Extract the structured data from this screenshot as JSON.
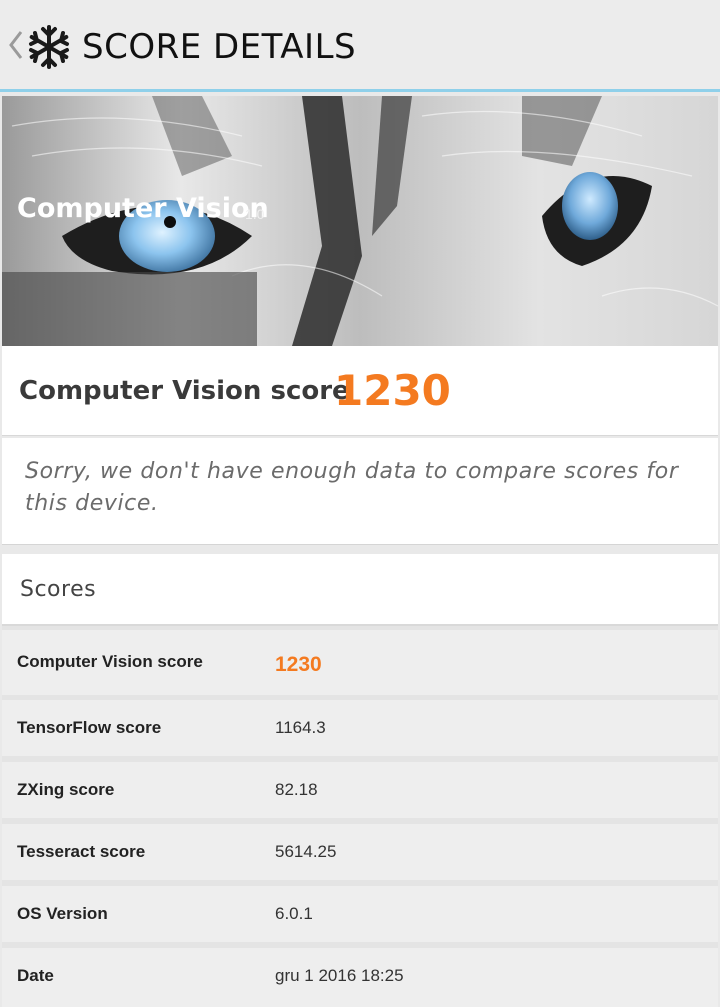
{
  "header": {
    "title": "SCORE DETAILS"
  },
  "hero": {
    "title": "Computer Vision",
    "version": "1.0"
  },
  "score_card": {
    "label": "Computer Vision score",
    "value": "1230"
  },
  "notice": {
    "text": "Sorry, we don't have enough data to compare scores for this device."
  },
  "scores": {
    "title": "Scores",
    "rows": [
      {
        "label": "Computer Vision score",
        "value": "1230"
      },
      {
        "label": "TensorFlow score",
        "value": "1164.3"
      },
      {
        "label": "ZXing score",
        "value": "82.18"
      },
      {
        "label": "Tesseract score",
        "value": "5614.25"
      },
      {
        "label": "OS Version",
        "value": "6.0.1"
      },
      {
        "label": "Date",
        "value": "gru 1 2016 18:25"
      }
    ]
  },
  "colors": {
    "accent": "#f47a20",
    "header_underline": "#8fd0ea"
  },
  "icons": {
    "back": "back-chevron-icon",
    "logo": "snowflake-logo-icon"
  }
}
